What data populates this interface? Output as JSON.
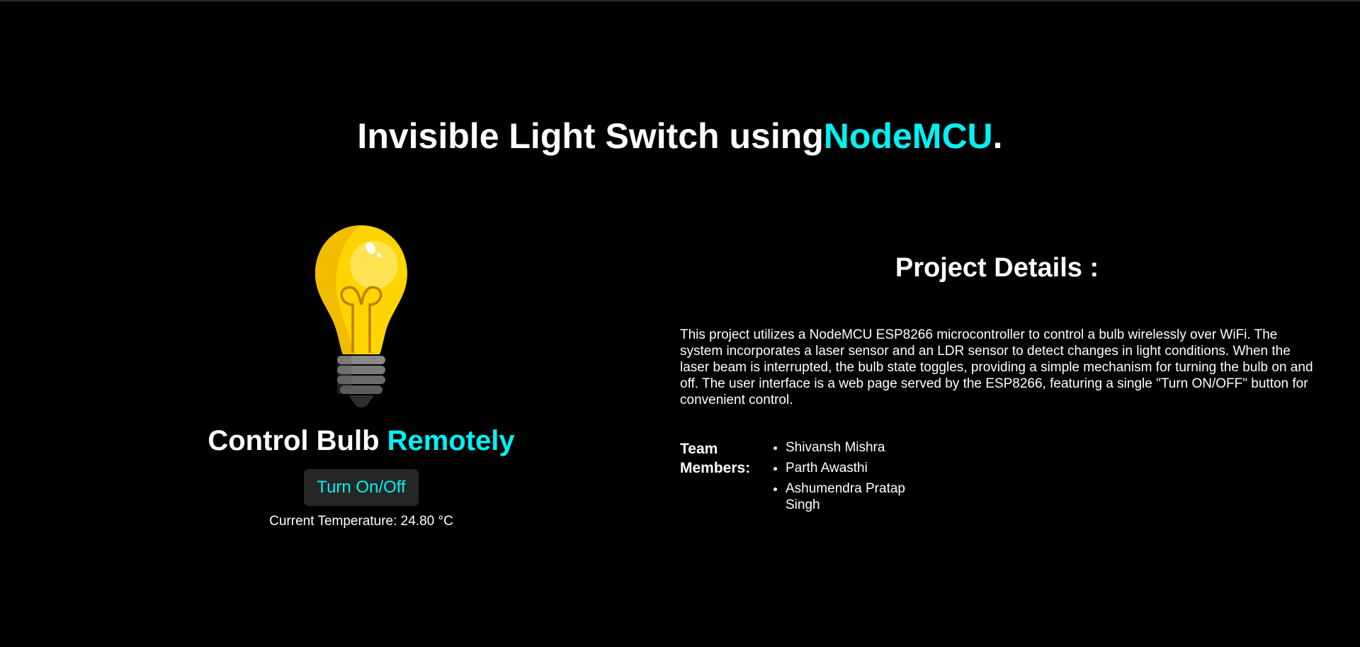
{
  "header": {
    "title_prefix": "Invisible Light Switch using",
    "title_accent": "NodeMCU",
    "title_suffix": "."
  },
  "control": {
    "heading_prefix": "Control Bulb ",
    "heading_accent": "Remotely",
    "button_label": "Turn On/Off",
    "temperature_text": "Current Temperature: 24.80 °C"
  },
  "details": {
    "heading": "Project Details :",
    "description": "This project utilizes a NodeMCU ESP8266 microcontroller to control a bulb wirelessly over WiFi. The system incorporates a laser sensor and an LDR sensor to detect changes in light conditions. When the laser beam is interrupted, the bulb state toggles, providing a simple mechanism for turning the bulb on and off. The user interface is a web page served by the ESP8266, featuring a single \"Turn ON/OFF\" button for convenient control.",
    "team_label": "Team Members:",
    "team_members": [
      "Shivansh Mishra",
      "Parth Awasthi",
      "Ashumendra Pratap Singh"
    ]
  },
  "colors": {
    "accent": "#00f2f2",
    "background": "#000000",
    "bulb_yellow": "#ffd400",
    "button_bg": "#262626"
  },
  "icons": {
    "bulb": "light-bulb-icon"
  }
}
